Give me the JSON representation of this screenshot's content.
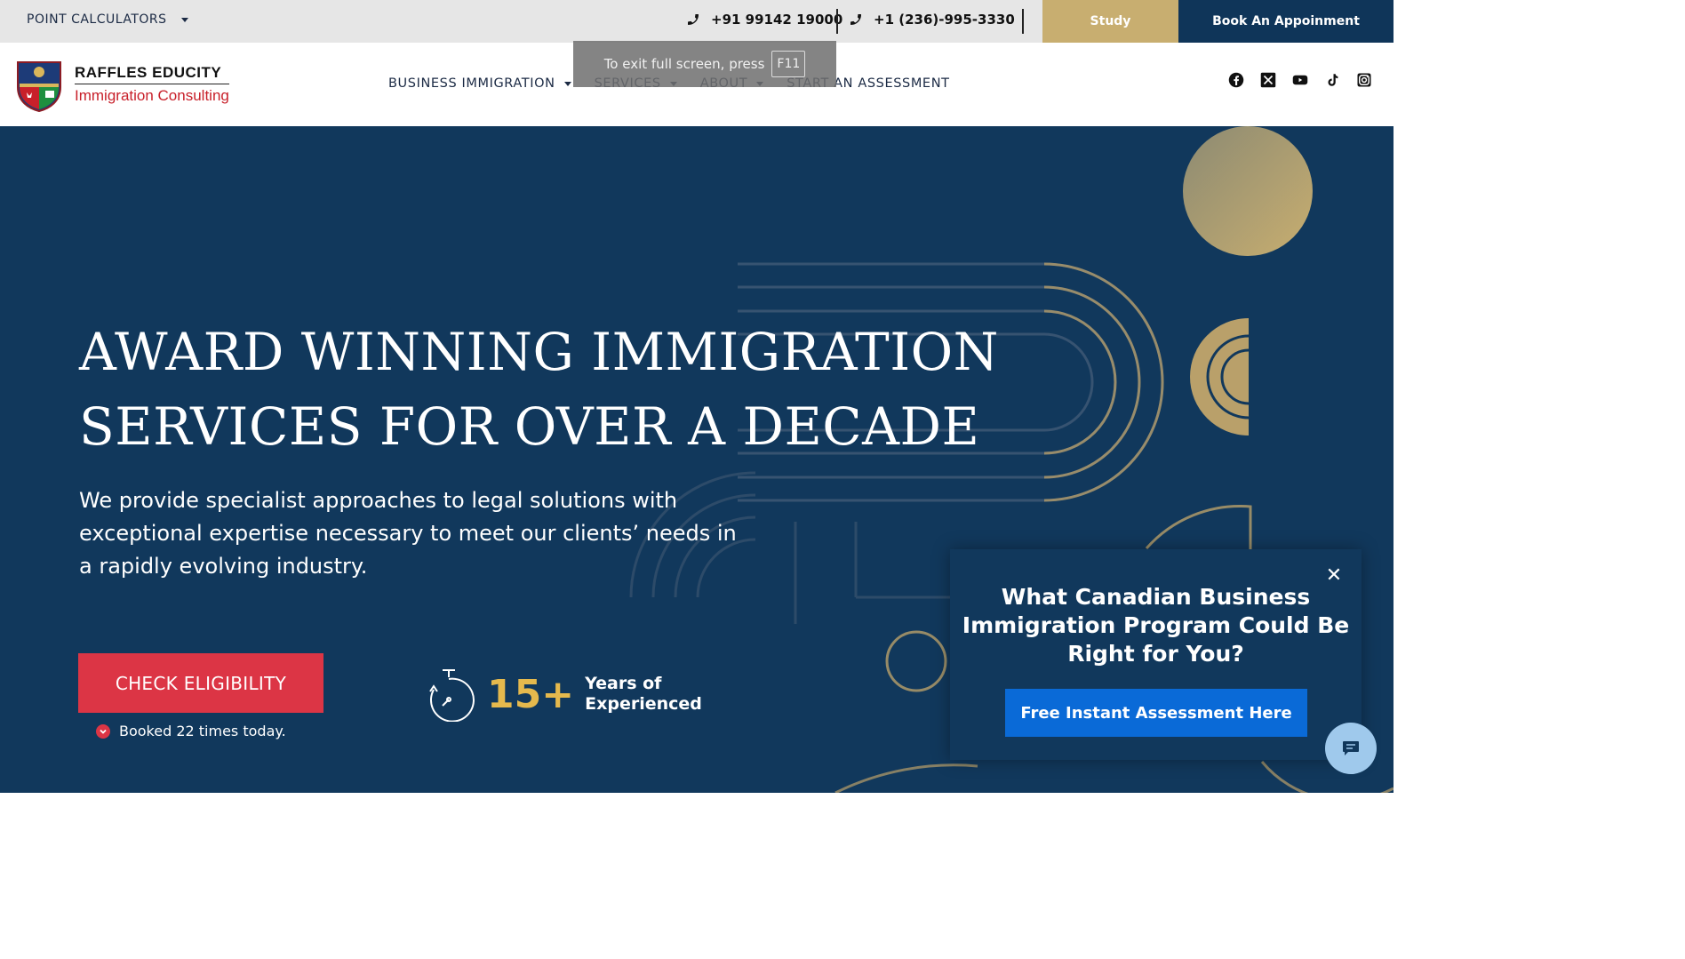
{
  "topbar": {
    "calculators_label": "POINT  CALCULATORS",
    "phone1": "+91 99142 19000",
    "phone2": "+1 (236)-995-3330",
    "study_label": "Study",
    "book_label": "Book An Appoinment",
    "colors": {
      "study_bg": "#c8ae70",
      "book_bg": "#0f3559",
      "bar_bg": "#e6e6e6"
    }
  },
  "header": {
    "logo_line1": "RAFFLES EDUCITY",
    "logo_line2": "Immigration Consulting",
    "nav": [
      {
        "label": "BUSINESS  IMMIGRATION",
        "dropdown": true
      },
      {
        "label": "SERVICES",
        "dropdown": true
      },
      {
        "label": "ABOUT",
        "dropdown": true
      },
      {
        "label": "START  AN  ASSESSMENT",
        "dropdown": false
      }
    ],
    "socials": [
      "facebook-icon",
      "x-icon",
      "youtube-icon",
      "tiktok-icon",
      "instagram-icon"
    ]
  },
  "fullscreen_tip": {
    "text": "To exit full screen, press",
    "key": "F11"
  },
  "hero": {
    "title_line1": "AWARD WINNING IMMIGRATION",
    "title_line2": "SERVICES FOR OVER A DECADE",
    "subtitle": "We provide specialist approaches to legal solutions with exceptional expertise necessary to meet our clients’ needs in a rapidly evolving industry.",
    "cta_label": "CHECK ELIGIBILITY",
    "booked_text": "Booked 22 times today.",
    "stat_number": "15+",
    "stat_label_line1": "Years of",
    "stat_label_line2": "Experienced",
    "colors": {
      "bg": "#11385c",
      "gold": "#c8ae70",
      "cta": "#dc3545",
      "stat": "#e5b94d"
    }
  },
  "popup": {
    "title": "What Canadian Business Immigration Program Could Be Right for You?",
    "button_label": "Free Instant Assessment Here",
    "close_icon": "close-icon"
  },
  "chat": {
    "icon": "chat-bubble-icon"
  }
}
